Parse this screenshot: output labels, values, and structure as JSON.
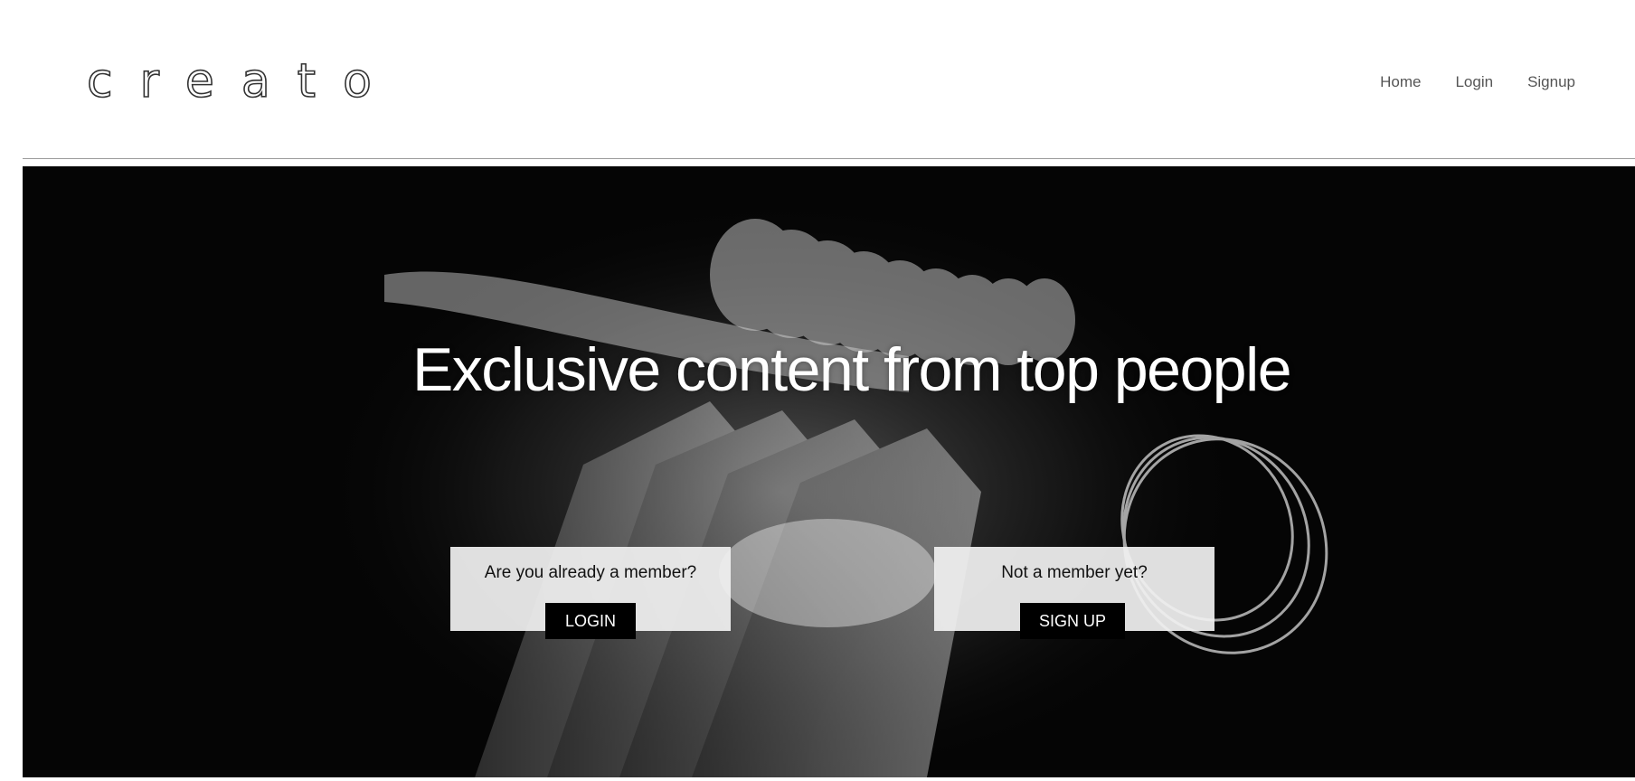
{
  "header": {
    "logo": "creato",
    "nav": [
      "Home",
      "Login",
      "Signup"
    ]
  },
  "hero": {
    "headline": "Exclusive content from top people",
    "login_card": {
      "question": "Are you already a member?",
      "button": "LOGIN"
    },
    "signup_card": {
      "question": "Not a member yet?",
      "button": "SIGN UP"
    }
  },
  "colors": {
    "hero_background": "#050505",
    "button_background": "#000000",
    "card_background": "#f0f0f0"
  }
}
